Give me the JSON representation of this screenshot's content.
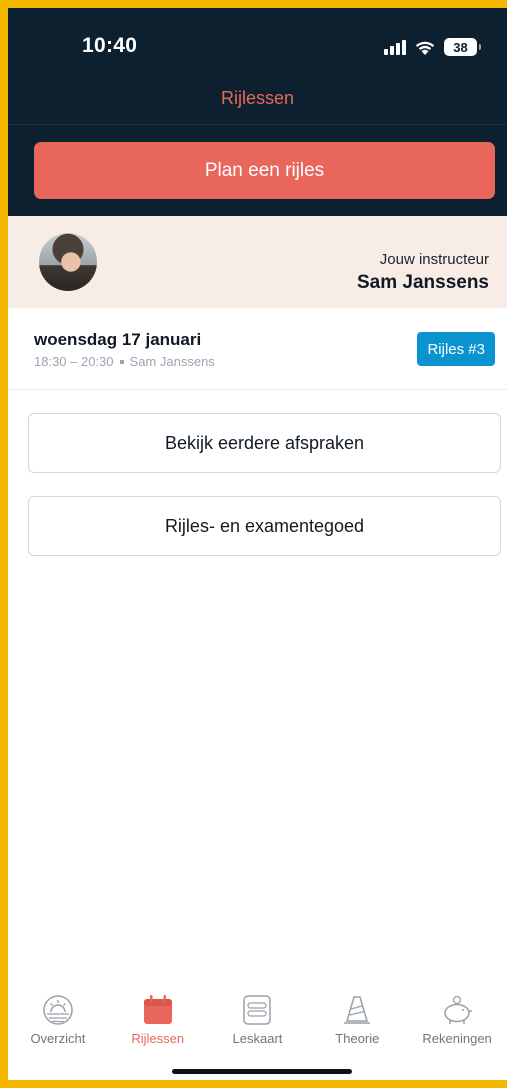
{
  "status": {
    "time": "10:40",
    "battery": "38"
  },
  "nav": {
    "title": "Rijlessen"
  },
  "plan_button": {
    "label": "Plan een rijles"
  },
  "instructor": {
    "label": "Jouw instructeur",
    "name": "Sam Janssens"
  },
  "lesson": {
    "date": "woensdag 17 januari",
    "time": "18:30 – 20:30",
    "instructor": "Sam Janssens",
    "badge": "Rijles #3"
  },
  "buttons": {
    "previous": "Bekijk eerdere afspraken",
    "credit": "Rijles- en examentegoed"
  },
  "tabs": [
    {
      "label": "Overzicht",
      "icon": "sun-icon",
      "active": false
    },
    {
      "label": "Rijlessen",
      "icon": "calendar-icon",
      "active": true
    },
    {
      "label": "Leskaart",
      "icon": "card-icon",
      "active": false
    },
    {
      "label": "Theorie",
      "icon": "cone-icon",
      "active": false
    },
    {
      "label": "Rekeningen",
      "icon": "piggy-bank-icon",
      "active": false
    }
  ],
  "colors": {
    "accent": "#e8675a",
    "header": "#0d2030",
    "badge": "#0b93d0"
  }
}
